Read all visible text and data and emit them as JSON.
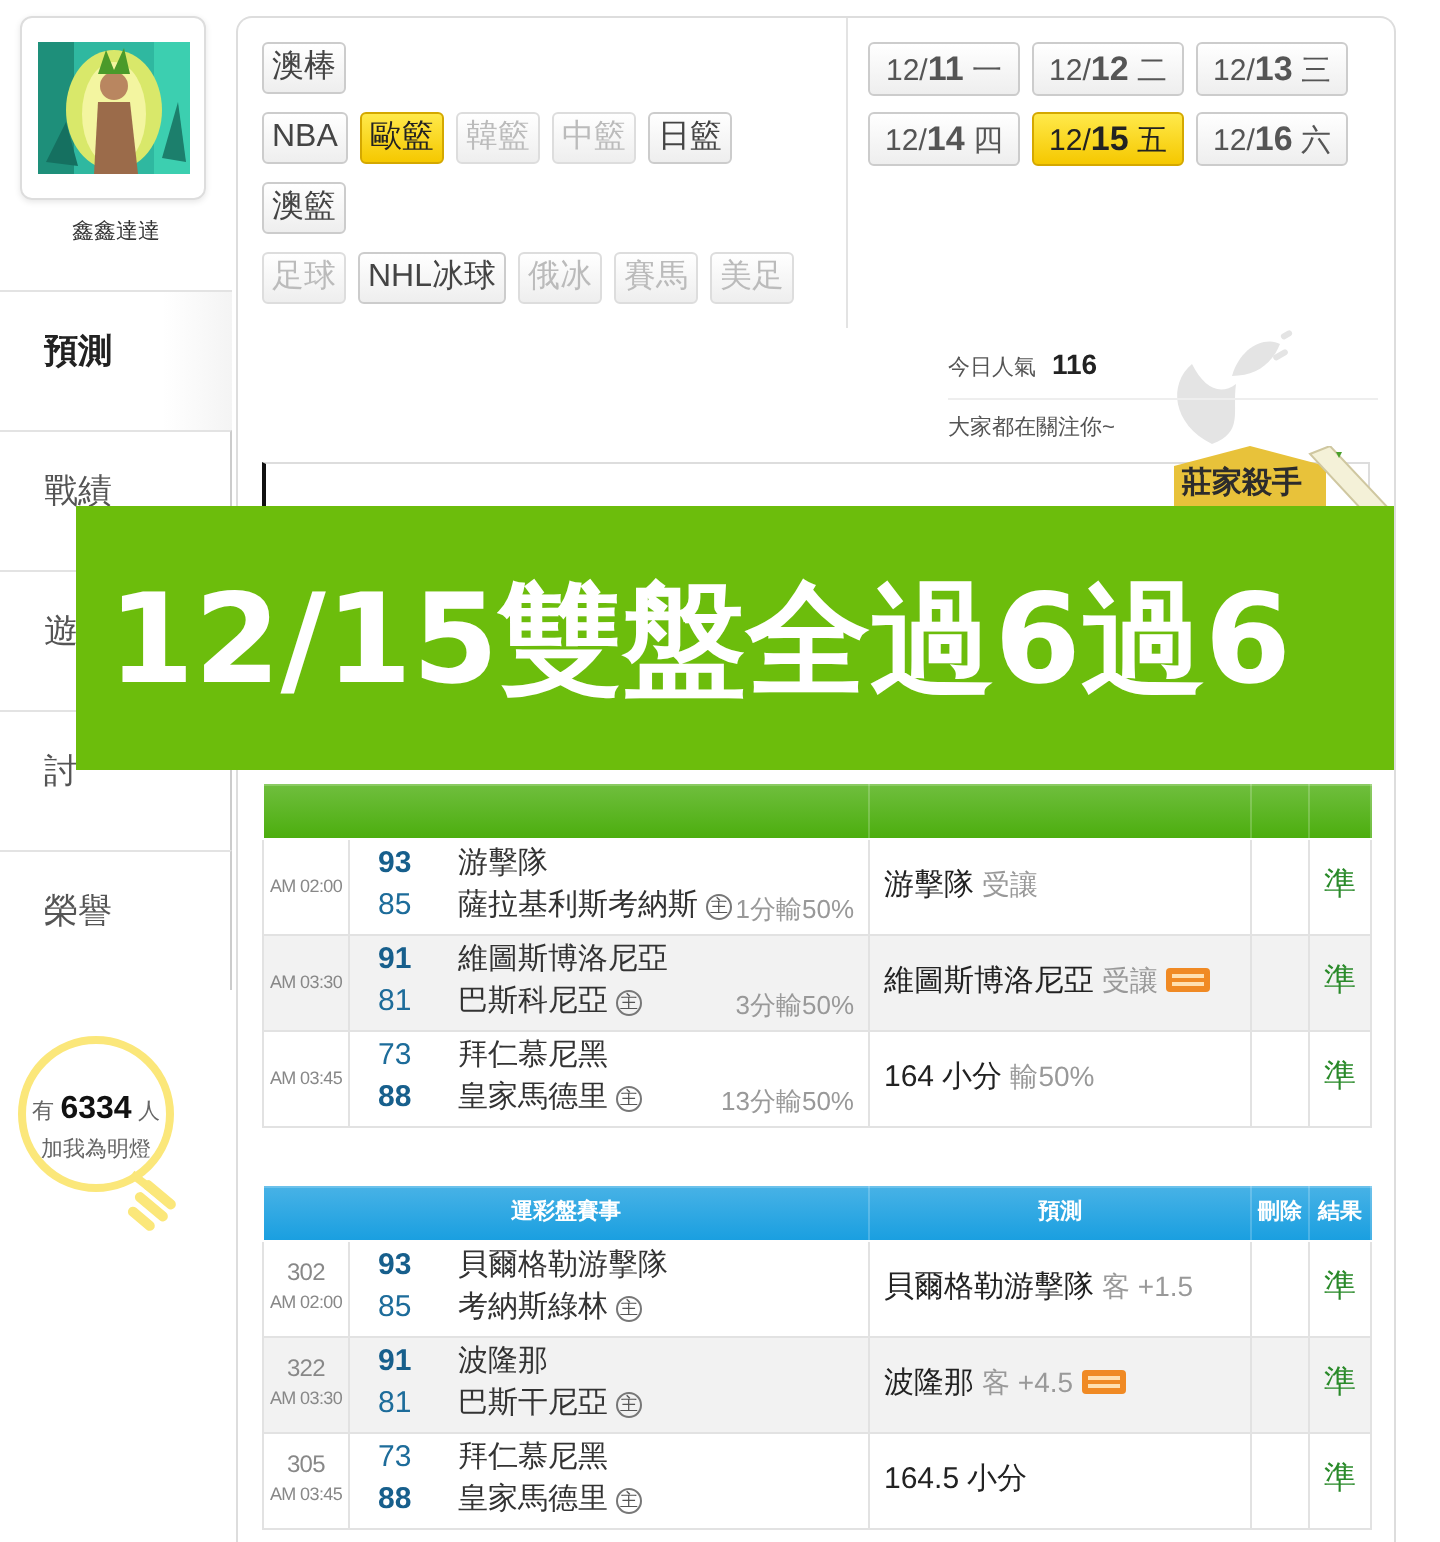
{
  "profile": {
    "name": "鑫鑫達達"
  },
  "sidebar": {
    "items": [
      {
        "label": "預測",
        "selected": true
      },
      {
        "label": "戰績",
        "selected": false
      },
      {
        "label": "遊",
        "selected": false
      },
      {
        "label": "討",
        "selected": false
      },
      {
        "label": "榮譽",
        "selected": false
      }
    ]
  },
  "fans": {
    "prefix": "有",
    "count": "6334",
    "suffix": "人",
    "caption": "加我為明燈"
  },
  "categories": [
    [
      {
        "label": "澳棒",
        "selected": false,
        "disabled": false
      }
    ],
    [
      {
        "label": "NBA",
        "selected": false,
        "disabled": false
      },
      {
        "label": "歐籃",
        "selected": true,
        "disabled": false
      },
      {
        "label": "韓籃",
        "selected": false,
        "disabled": true
      },
      {
        "label": "中籃",
        "selected": false,
        "disabled": true
      },
      {
        "label": "日籃",
        "selected": false,
        "disabled": false
      }
    ],
    [
      {
        "label": "澳籃",
        "selected": false,
        "disabled": false
      }
    ],
    [
      {
        "label": "足球",
        "selected": false,
        "disabled": true
      },
      {
        "label": "NHL冰球",
        "selected": false,
        "disabled": false
      },
      {
        "label": "俄冰",
        "selected": false,
        "disabled": true
      },
      {
        "label": "賽馬",
        "selected": false,
        "disabled": true
      },
      {
        "label": "美足",
        "selected": false,
        "disabled": true
      }
    ]
  ],
  "dates": [
    {
      "label": "12/**11** 一",
      "selected": false
    },
    {
      "label": "12/**12** 二",
      "selected": false
    },
    {
      "label": "12/**13** 三",
      "selected": false
    },
    {
      "label": "12/**14** 四",
      "selected": false
    },
    {
      "label": "12/**15** 五",
      "selected": true
    },
    {
      "label": "12/**16** 六",
      "selected": false
    }
  ],
  "popularity": {
    "label": "今日人氣",
    "count": "116",
    "note": "大家都在關注你~"
  },
  "ribbon": {
    "label": "莊家殺手"
  },
  "banner": {
    "text": "12/15雙盤全過6過6"
  },
  "tables": [
    {
      "color": "#4cae0e",
      "rows": [
        {
          "time": "AM 02:00",
          "teams": [
            {
              "score": "93",
              "name": "游擊隊",
              "winner": true
            },
            {
              "score": "85",
              "name": "薩拉基利斯考納斯",
              "winner": false,
              "mark": "主"
            }
          ],
          "spread": "1分輸50%",
          "pick": "游擊隊",
          "note": "受讓",
          "featured": false,
          "result": "準"
        },
        {
          "time": "AM 03:30",
          "teams": [
            {
              "score": "91",
              "name": "維圖斯博洛尼亞",
              "winner": true
            },
            {
              "score": "81",
              "name": "巴斯科尼亞",
              "winner": false,
              "mark": "主"
            }
          ],
          "spread": "3分輸50%",
          "pick": "維圖斯博洛尼亞",
          "note": "受讓",
          "featured": true,
          "result": "準"
        },
        {
          "time": "AM 03:45",
          "teams": [
            {
              "score": "73",
              "name": "拜仁慕尼黑",
              "winner": false
            },
            {
              "score": "88",
              "name": "皇家馬德里",
              "winner": true,
              "mark": "主"
            }
          ],
          "spread": "13分輸50%",
          "pick": "164 小分",
          "note": "輸50%",
          "featured": false,
          "result": "準"
        }
      ]
    },
    {
      "color": "#1a9fe0",
      "columns": [
        "運彩盤賽事",
        "預測",
        "刪除",
        "結果"
      ],
      "rows": [
        {
          "code": "302",
          "time": "AM 02:00",
          "teams": [
            {
              "score": "93",
              "name": "貝爾格勒游擊隊",
              "winner": true
            },
            {
              "score": "85",
              "name": "考納斯綠林",
              "winner": false,
              "mark": "主"
            }
          ],
          "pick": "貝爾格勒游擊隊",
          "note": "客 +1.5",
          "featured": false,
          "result": "準"
        },
        {
          "code": "322",
          "time": "AM 03:30",
          "teams": [
            {
              "score": "91",
              "name": "波隆那",
              "winner": true
            },
            {
              "score": "81",
              "name": "巴斯干尼亞",
              "winner": false,
              "mark": "主"
            }
          ],
          "pick": "波隆那",
          "note": "客 +4.5",
          "featured": true,
          "result": "準"
        },
        {
          "code": "305",
          "time": "AM 03:45",
          "teams": [
            {
              "score": "73",
              "name": "拜仁慕尼黑",
              "winner": false
            },
            {
              "score": "88",
              "name": "皇家馬德里",
              "winner": true,
              "mark": "主"
            }
          ],
          "pick": "164.5 小分",
          "featured": false,
          "result": "準"
        }
      ]
    }
  ]
}
